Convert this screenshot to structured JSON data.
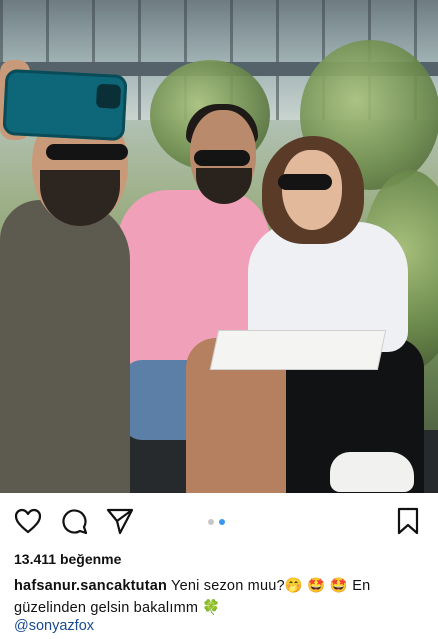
{
  "post": {
    "image_alt": "",
    "carousel": {
      "count": 2,
      "active_index": 1
    }
  },
  "actions": {
    "like_icon": "heart-outline-icon",
    "comment_icon": "comment-outline-icon",
    "share_icon": "paper-plane-icon",
    "save_icon": "bookmark-outline-icon"
  },
  "likes": {
    "text": "13.411 beğenme"
  },
  "caption": {
    "username": "hafsanur.sancaktutan",
    "line1_text": "Yeni sezon muu?",
    "line1_emojis": "🤭 🤩 🤩",
    "line1_tail": "En",
    "line2_text": "güzelinden gelsin bakalımm",
    "line2_emoji": "🍀"
  },
  "mention": {
    "text": "@sonyazfox"
  },
  "colors": {
    "accent": "#3897f0",
    "mention": "#1a4a8f"
  }
}
